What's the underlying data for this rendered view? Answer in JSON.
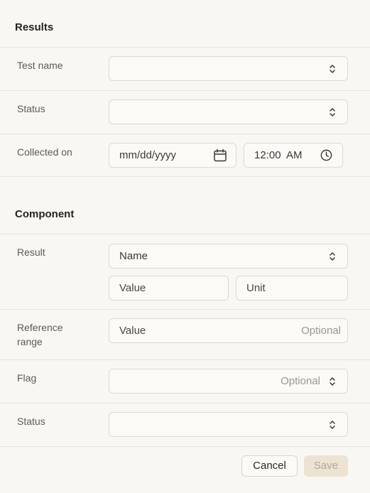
{
  "results": {
    "title": "Results",
    "test_name_label": "Test name",
    "status_label": "Status",
    "collected_on_label": "Collected on",
    "date_value": "mm/dd/yyyy",
    "time_value": "12:00  AM"
  },
  "component": {
    "title": "Component",
    "result_label": "Result",
    "name_value": "Name",
    "value_placeholder": "Value",
    "unit_placeholder": "Unit",
    "reference_range_label": "Reference range",
    "reference_value_placeholder": "Value",
    "reference_optional": "Optional",
    "flag_label": "Flag",
    "flag_optional": "Optional",
    "status_label": "Status"
  },
  "actions": {
    "cancel_label": "Cancel",
    "save_label": "Save"
  },
  "icons": {
    "select_chevron": "chevron-up-down-icon",
    "date": "calendar-icon",
    "time": "clock-icon"
  },
  "colors": {
    "background": "#f9f7f3",
    "save_disabled_bg": "#ece3d3",
    "save_disabled_text": "#b2a896"
  }
}
